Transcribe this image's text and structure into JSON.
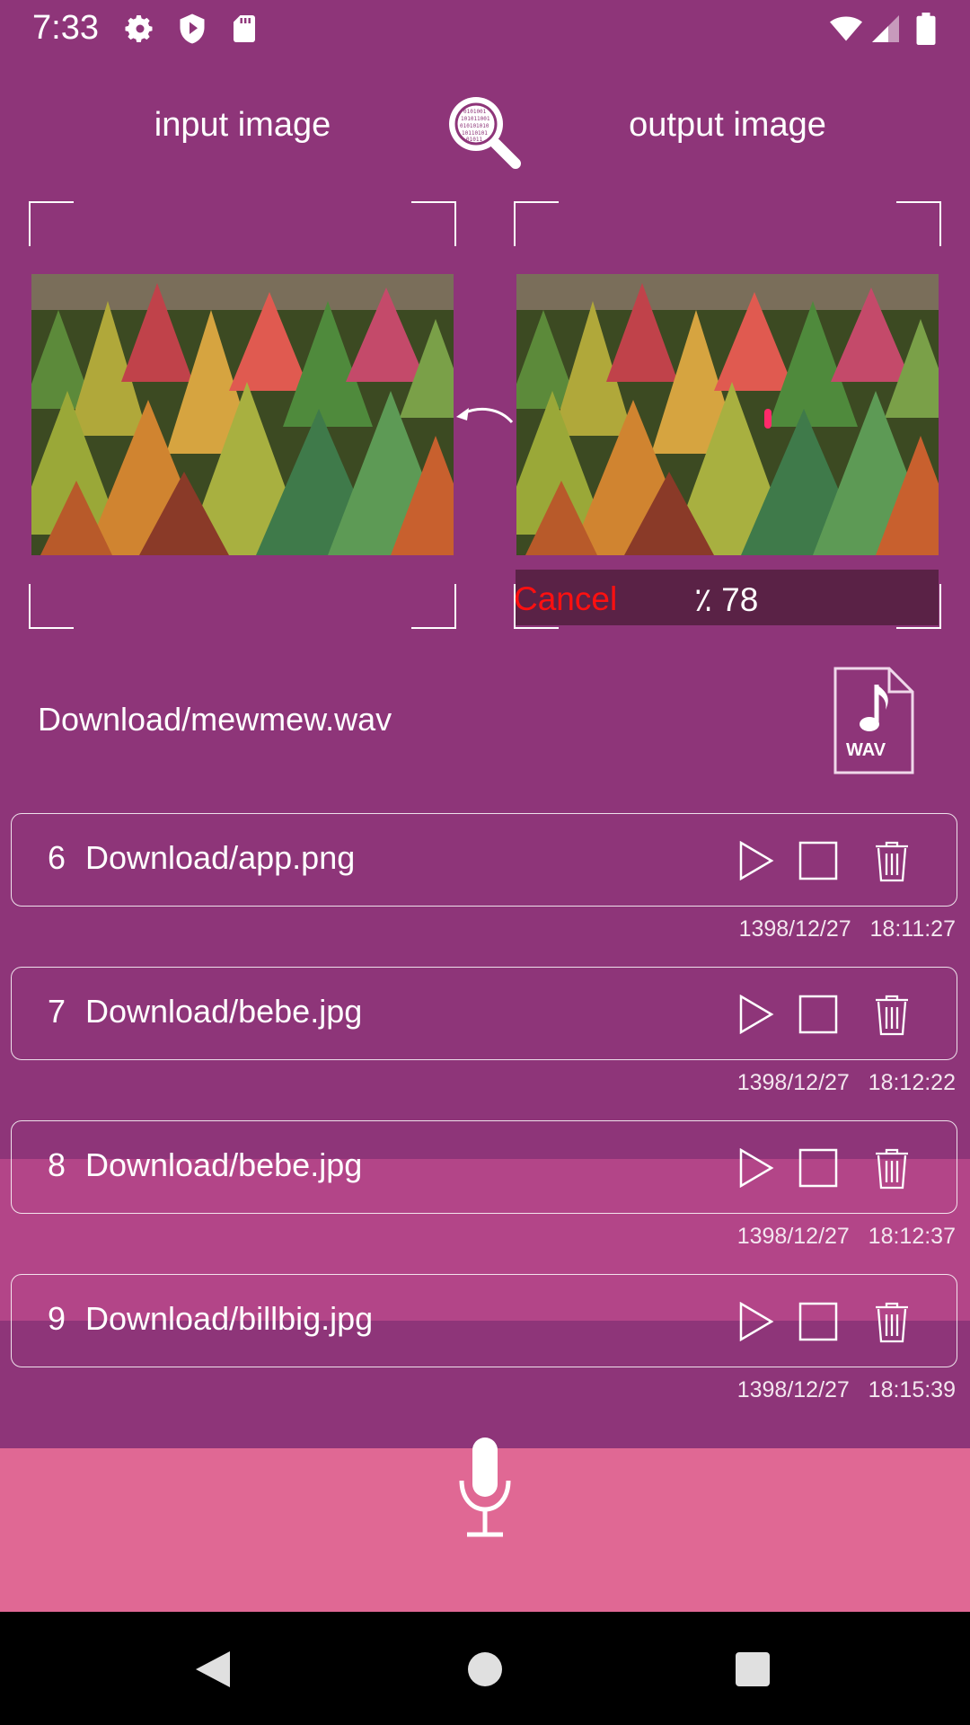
{
  "status_bar": {
    "time": "7:33",
    "icons": [
      "gear-icon",
      "shield-play-icon",
      "sd-card-icon",
      "wifi-icon",
      "signal-icon",
      "battery-icon"
    ]
  },
  "headings": {
    "input": "input image",
    "output": "output image"
  },
  "progress": {
    "cancel_label": "Cancel",
    "value_text": "٪ 78"
  },
  "audio_file": {
    "path": "Download/mewmew.wav",
    "icon_label": "WAV"
  },
  "history": [
    {
      "index": "6",
      "name": "Download/app.png",
      "date": "1398/12/27",
      "time": "18:11:27"
    },
    {
      "index": "7",
      "name": "Download/bebe.jpg",
      "date": "1398/12/27",
      "time": "18:12:22"
    },
    {
      "index": "8",
      "name": "Download/bebe.jpg",
      "date": "1398/12/27",
      "time": "18:12:37"
    },
    {
      "index": "9",
      "name": "Download/billbig.jpg",
      "date": "1398/12/27",
      "time": "18:15:39"
    }
  ],
  "colors": {
    "background": "#8e3579",
    "record_bar": "#e06894",
    "cancel": "#ff1010"
  }
}
